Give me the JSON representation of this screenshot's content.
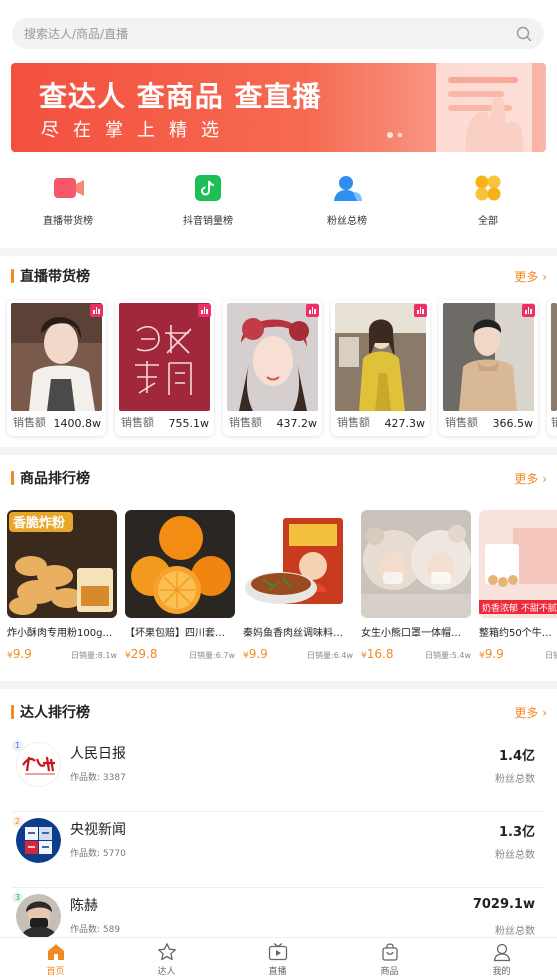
{
  "search": {
    "placeholder": "搜索达人/商品/直播"
  },
  "banner": {
    "line1": "查达人 查商品 查直播",
    "line2": "尽在掌上精选"
  },
  "quick_nav": [
    {
      "label": "直播带货榜",
      "icon": "video-camera-icon",
      "color": "#f7576b"
    },
    {
      "label": "抖音销量榜",
      "icon": "tiktok-icon",
      "color": "#1fbf58"
    },
    {
      "label": "粉丝总榜",
      "icon": "user-icon",
      "color": "#2f8ff0"
    },
    {
      "label": "全部",
      "icon": "grid-icon",
      "color": "#f7b217"
    }
  ],
  "sections": {
    "live": {
      "title": "直播带货榜",
      "more": "更多"
    },
    "product": {
      "title": "商品排行榜",
      "more": "更多"
    },
    "talent": {
      "title": "达人排行榜",
      "more": "更多"
    }
  },
  "live_cards": [
    {
      "label": "销售额",
      "value": "1400.8w",
      "img": "portrait-woman-vest"
    },
    {
      "label": "销售额",
      "value": "755.1w",
      "img": "red-logo-text"
    },
    {
      "label": "销售额",
      "value": "437.2w",
      "img": "portrait-woman-red-hat"
    },
    {
      "label": "销售额",
      "value": "427.3w",
      "img": "portrait-woman-yellow-sweater"
    },
    {
      "label": "销售额",
      "value": "366.5w",
      "img": "portrait-man-sweater"
    },
    {
      "label": "销",
      "value": "",
      "img": "partial"
    }
  ],
  "product_cards": [
    {
      "name": "炸小酥肉专用粉100g…",
      "currency": "¥",
      "price": "9.9",
      "daily": "日销量:8.1w",
      "img_text": "香脆炸粉"
    },
    {
      "name": "【坏果包赔】四川套…",
      "currency": "¥",
      "price": "29.8",
      "daily": "日销量:6.7w",
      "img_text": ""
    },
    {
      "name": "秦妈鱼香肉丝调味料…",
      "currency": "¥",
      "price": "9.9",
      "daily": "日销量:6.4w",
      "img_text": ""
    },
    {
      "name": "女生小熊口罩一体帽…",
      "currency": "¥",
      "price": "16.8",
      "daily": "日销量:5.4w",
      "img_text": ""
    },
    {
      "name": "整箱约50个牛奶…",
      "currency": "¥",
      "price": "9.9",
      "daily": "日销",
      "img_text": "奶香浓郁 不甜不腻"
    }
  ],
  "talents": [
    {
      "rank": "1",
      "name": "人民日报",
      "works": "作品数: 3387",
      "fans": "1.4亿",
      "fans_label": "粉丝总数"
    },
    {
      "rank": "2",
      "name": "央视新闻",
      "works": "作品数: 5770",
      "fans": "1.3亿",
      "fans_label": "粉丝总数"
    },
    {
      "rank": "3",
      "name": "陈赫",
      "works": "作品数: 589",
      "fans": "7029.1w",
      "fans_label": "粉丝总数"
    }
  ],
  "bottom_nav": [
    {
      "label": "首页",
      "icon": "home-icon",
      "active": true
    },
    {
      "label": "达人",
      "icon": "star-icon",
      "active": false
    },
    {
      "label": "直播",
      "icon": "tv-icon",
      "active": false
    },
    {
      "label": "商品",
      "icon": "shopping-bag-icon",
      "active": false
    },
    {
      "label": "我的",
      "icon": "profile-icon",
      "active": false
    }
  ],
  "colors": {
    "accent": "#f08a24",
    "banner": "#f3503e"
  }
}
